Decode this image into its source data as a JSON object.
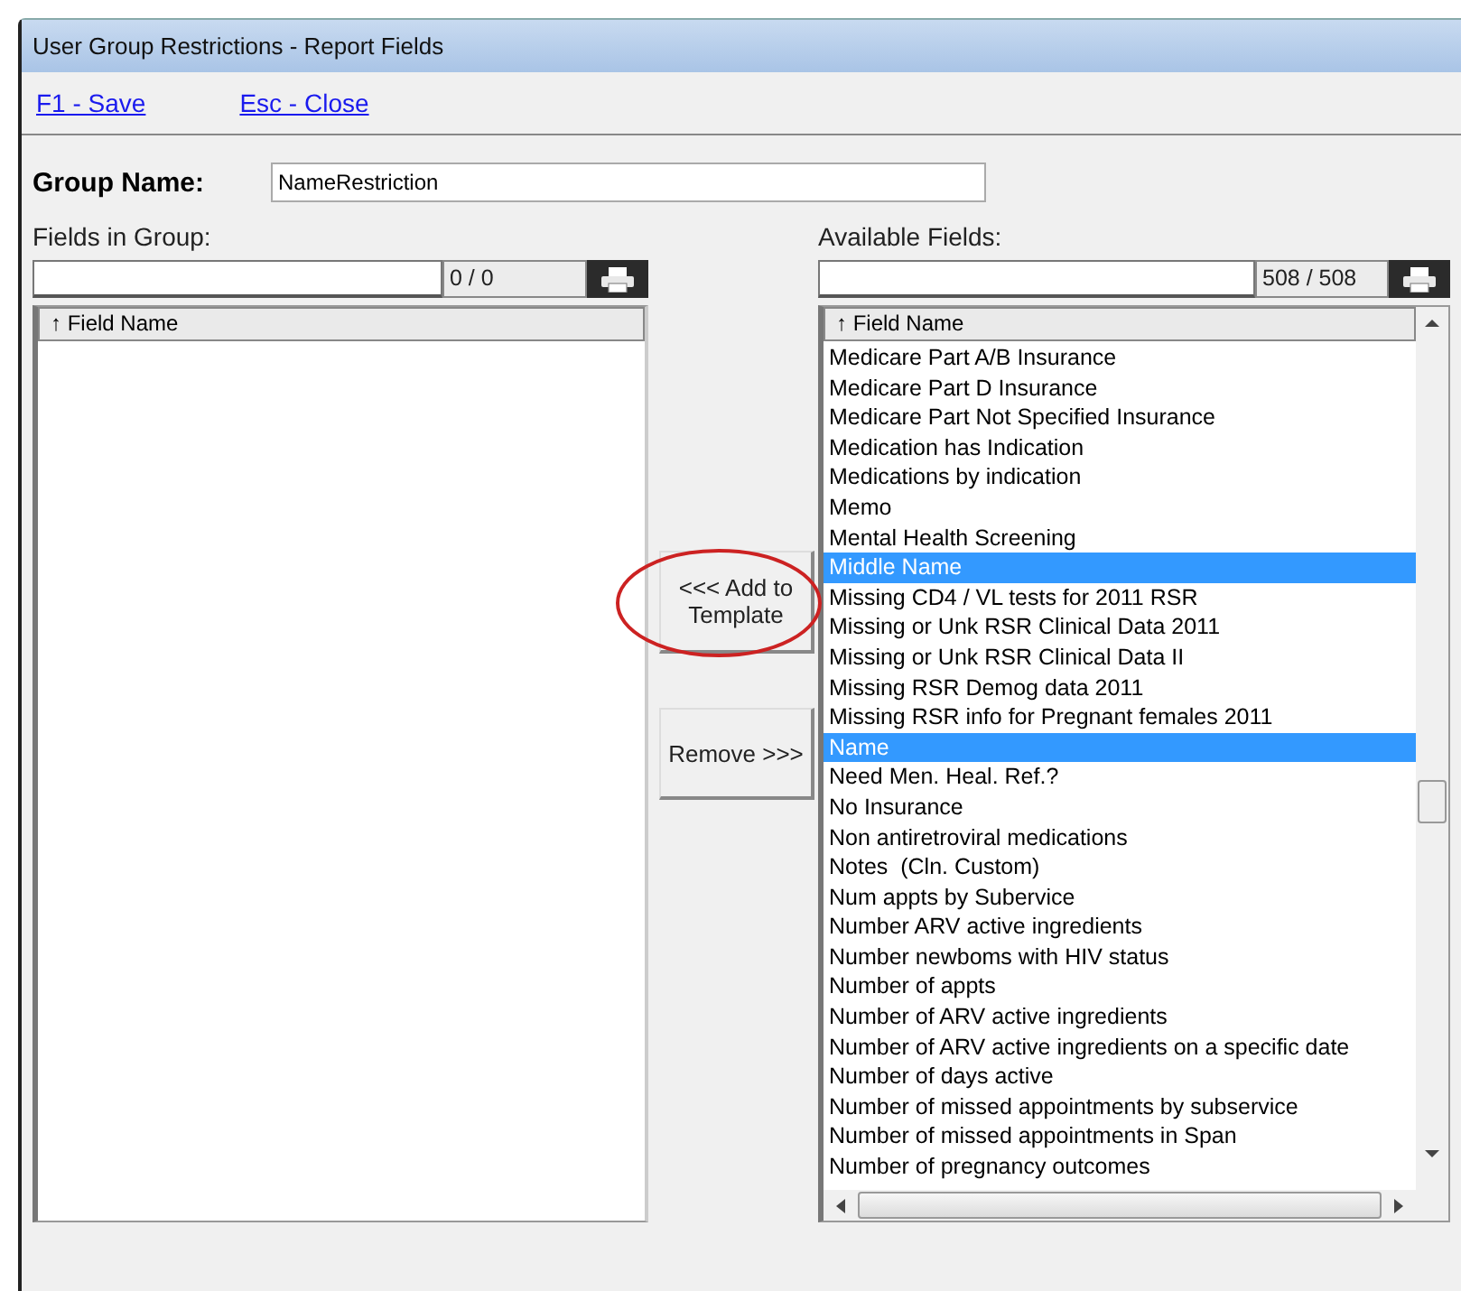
{
  "window": {
    "title": "User Group Restrictions - Report Fields"
  },
  "toolbar": {
    "links": [
      "F1 - Save",
      "Esc - Close"
    ]
  },
  "group_name": {
    "label": "Group Name:",
    "value": "NameRestriction"
  },
  "fields_in_group": {
    "label": "Fields in Group:",
    "count": "0 / 0",
    "column": "↑ Field Name"
  },
  "buttons": {
    "add": "<<<  Add to Template",
    "remove": "Remove >>>"
  },
  "available_fields": {
    "label": "Available Fields:",
    "count": "508 / 508",
    "column": "↑ Field Name",
    "rows": [
      {
        "text": "Medicare Part A/B Insurance",
        "selected": false
      },
      {
        "text": "Medicare Part D Insurance",
        "selected": false
      },
      {
        "text": "Medicare Part Not Specified Insurance",
        "selected": false
      },
      {
        "text": "Medication has Indication",
        "selected": false
      },
      {
        "text": "Medications by indication",
        "selected": false
      },
      {
        "text": "Memo",
        "selected": false
      },
      {
        "text": "Mental Health Screening",
        "selected": false
      },
      {
        "text": "Middle Name",
        "selected": true
      },
      {
        "text": "Missing CD4 / VL tests for 2011 RSR",
        "selected": false
      },
      {
        "text": "Missing or Unk RSR Clinical Data 2011",
        "selected": false
      },
      {
        "text": "Missing or Unk RSR Clinical Data II",
        "selected": false
      },
      {
        "text": "Missing RSR Demog data 2011",
        "selected": false
      },
      {
        "text": "Missing RSR info for Pregnant females 2011",
        "selected": false
      },
      {
        "text": "Name",
        "selected": true
      },
      {
        "text": "Need Men. Heal. Ref.?",
        "selected": false
      },
      {
        "text": "No Insurance",
        "selected": false
      },
      {
        "text": "Non antiretroviral medications",
        "selected": false
      },
      {
        "text": "Notes  (Cln. Custom)",
        "selected": false
      },
      {
        "text": "Num appts by Subervice",
        "selected": false
      },
      {
        "text": "Number ARV active ingredients",
        "selected": false
      },
      {
        "text": "Number newboms with HIV status",
        "selected": false
      },
      {
        "text": "Number of appts",
        "selected": false
      },
      {
        "text": "Number of ARV active ingredients",
        "selected": false
      },
      {
        "text": "Number of ARV active ingredients on a specific date",
        "selected": false
      },
      {
        "text": "Number of days active",
        "selected": false
      },
      {
        "text": "Number of missed appointments by subservice",
        "selected": false
      },
      {
        "text": "Number of missed appointments in Span",
        "selected": false
      },
      {
        "text": "Number of pregnancy outcomes",
        "selected": false
      }
    ]
  }
}
